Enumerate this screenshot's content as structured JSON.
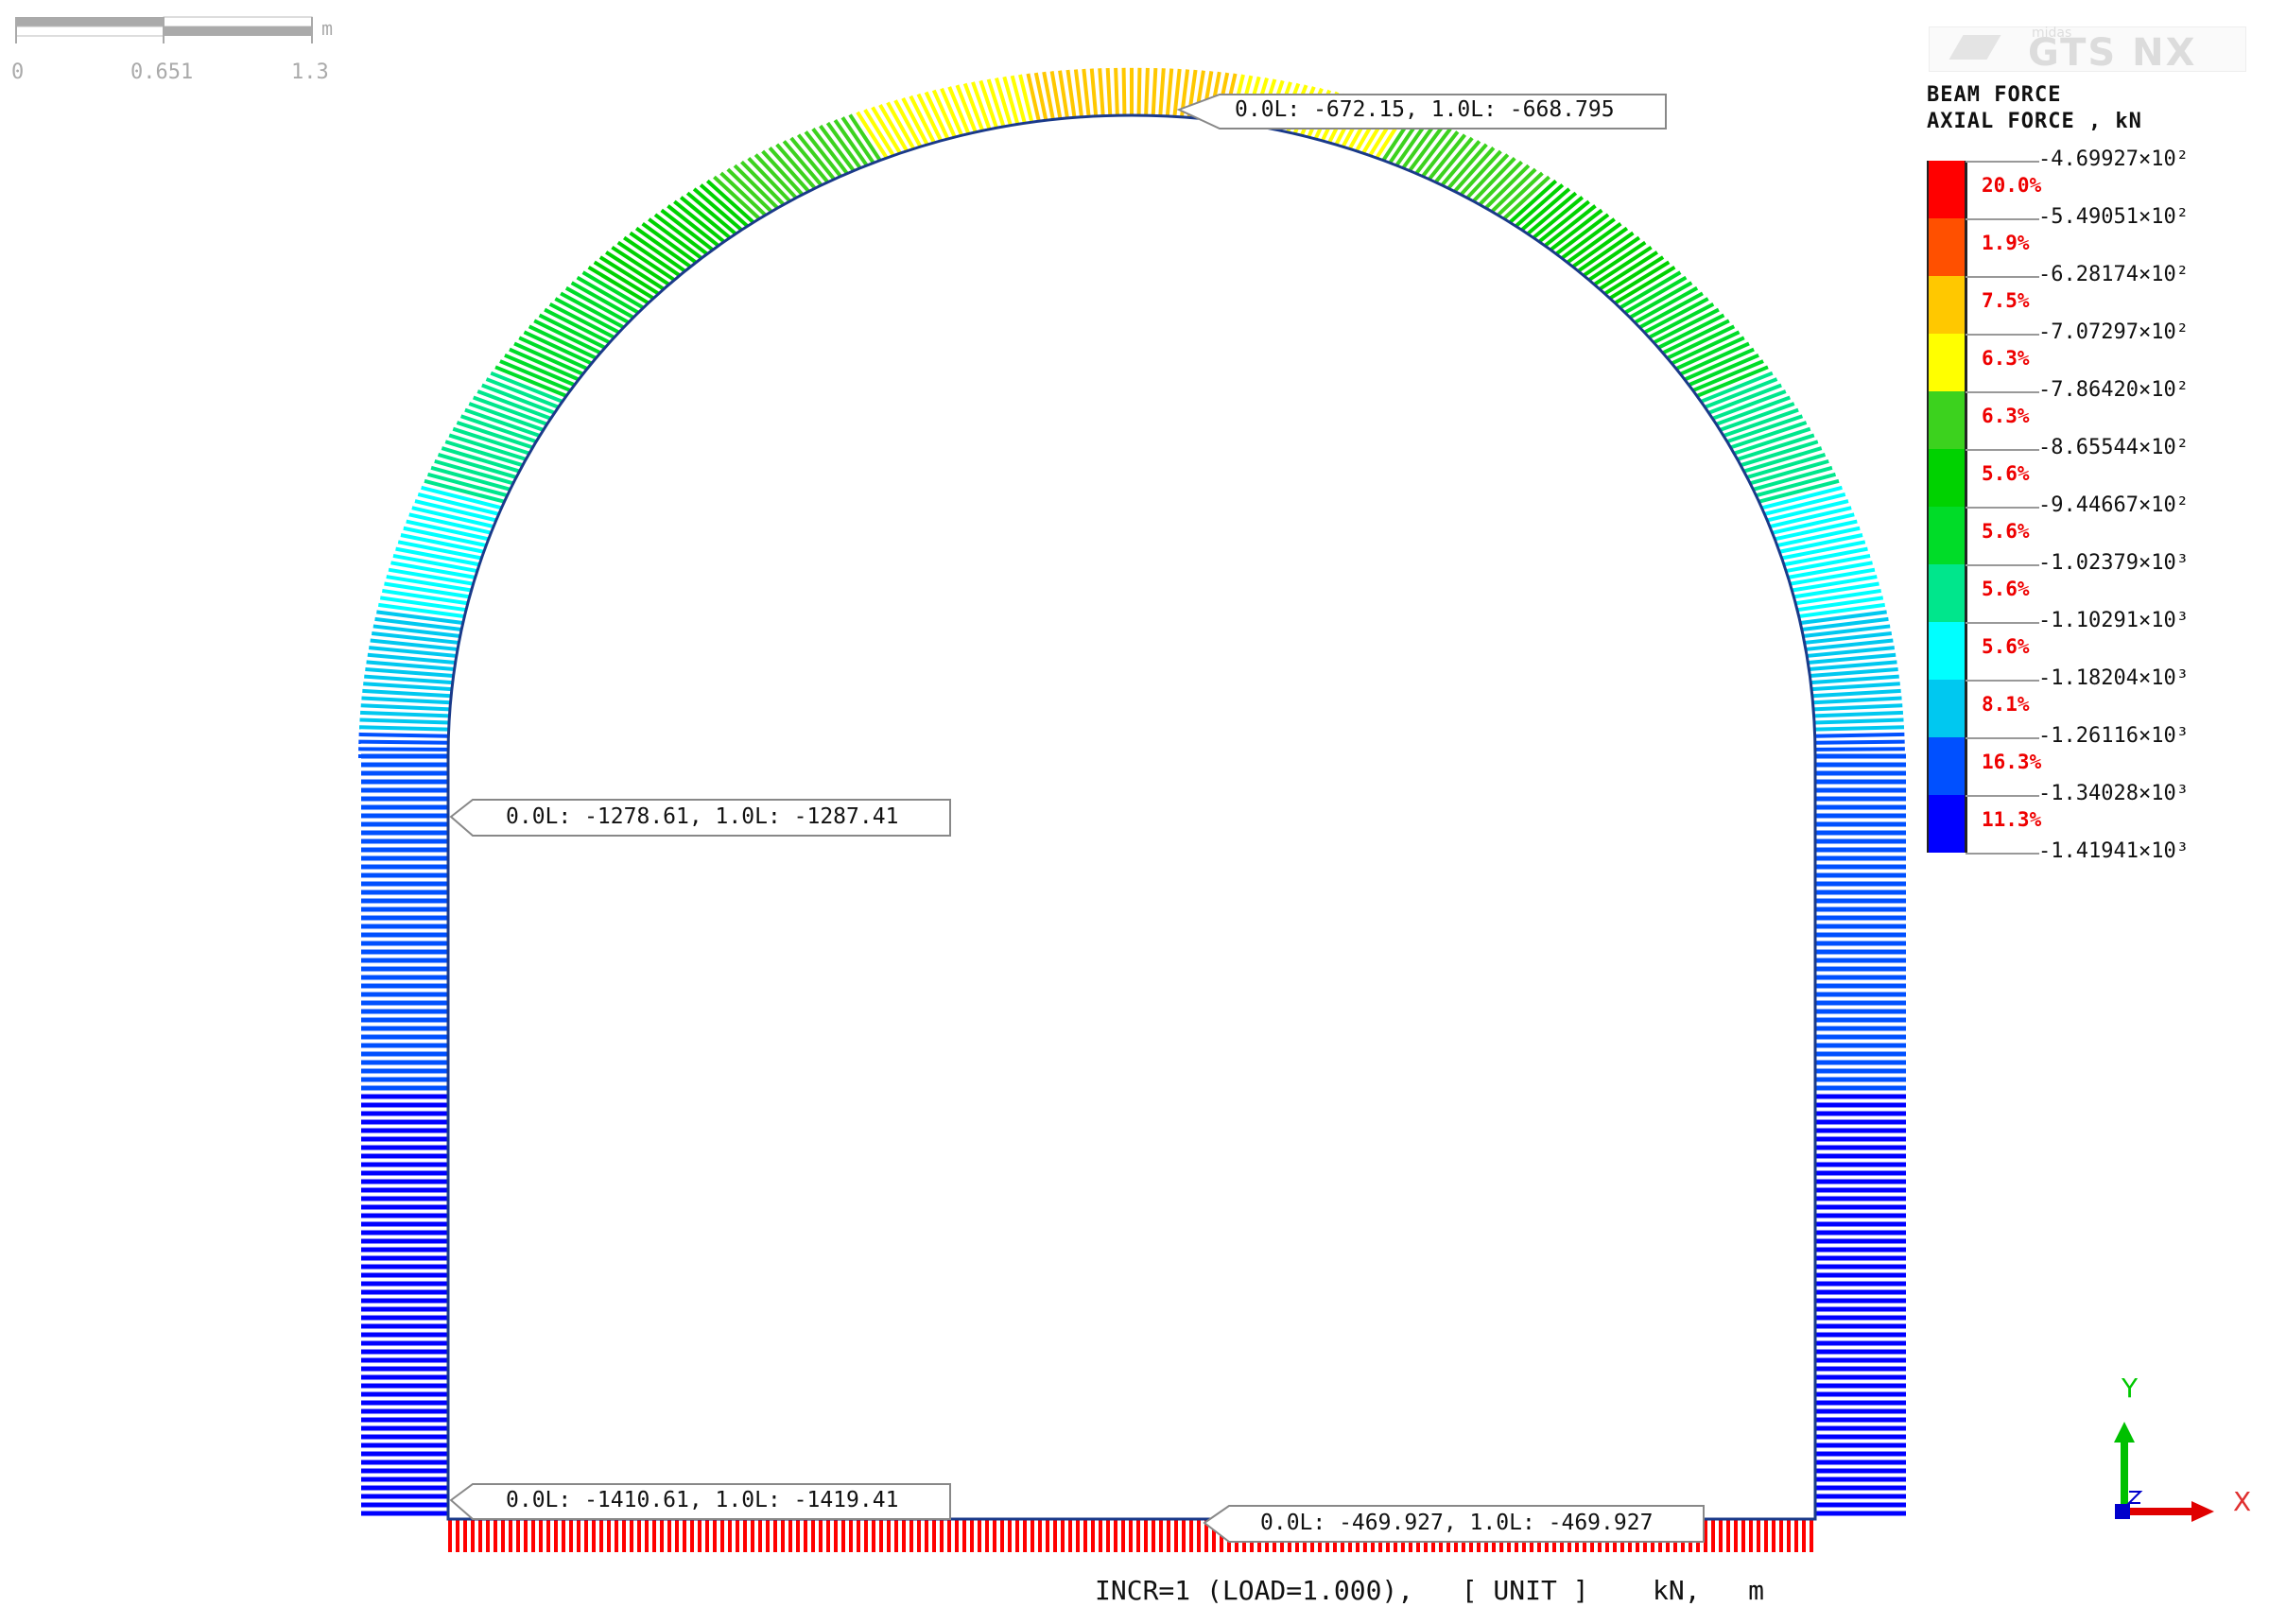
{
  "scale_bar": {
    "labels": [
      "0",
      "0.651",
      "1.3"
    ],
    "unit": "m"
  },
  "logo": {
    "small": "midas",
    "text": "GTS NX"
  },
  "legend": {
    "title": "BEAM FORCE",
    "subtitle": "AXIAL FORCE , kN",
    "ticks": [
      "-4.69927×10²",
      "-5.49051×10²",
      "-6.28174×10²",
      "-7.07297×10²",
      "-7.86420×10²",
      "-8.65544×10²",
      "-9.44667×10²",
      "-1.02379×10³",
      "-1.10291×10³",
      "-1.18204×10³",
      "-1.26116×10³",
      "-1.34028×10³",
      "-1.41941×10³"
    ],
    "tick_values": [
      -469.927,
      -549.051,
      -628.174,
      -707.297,
      -786.42,
      -865.544,
      -944.667,
      -1023.79,
      -1102.91,
      -1182.04,
      -1261.16,
      -1340.28,
      -1419.41
    ],
    "percents": [
      "20.0%",
      "1.9%",
      "7.5%",
      "6.3%",
      "6.3%",
      "5.6%",
      "5.6%",
      "5.6%",
      "5.6%",
      "8.1%",
      "16.3%",
      "11.3%"
    ],
    "colors": [
      "#ff0000",
      "#ff5000",
      "#ffc800",
      "#ffff00",
      "#3cd21e",
      "#00d200",
      "#00dc28",
      "#00e68c",
      "#00ffff",
      "#00c8f0",
      "#0050ff",
      "#0000ff"
    ]
  },
  "callouts": [
    {
      "text": "0.0L: -672.15, 1.0L: -668.795"
    },
    {
      "text": "0.0L: -1278.61, 1.0L: -1287.41"
    },
    {
      "text": "0.0L: -1410.61, 1.0L: -1419.41"
    },
    {
      "text": "0.0L: -469.927, 1.0L: -469.927"
    }
  ],
  "diagram_values": {
    "crown": -670,
    "springline": -1279,
    "wall_base": -1419,
    "invert": -469.927
  },
  "footer": "INCR=1 (LOAD=1.000),   [ UNIT ]    kN,   m",
  "axes": {
    "x": "X",
    "y": "Y",
    "z": "Z",
    "x_color": "#ff0000",
    "y_color": "#00c800",
    "z_color": "#0000cc"
  }
}
